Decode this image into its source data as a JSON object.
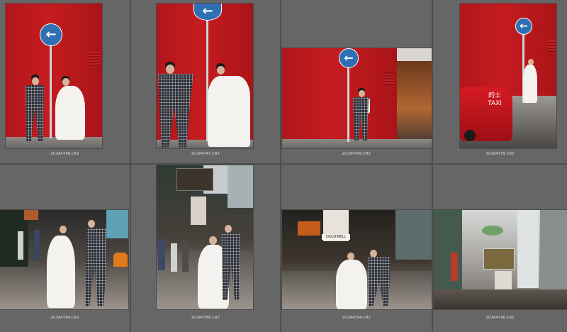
{
  "grid": {
    "background": "#5c5c5c",
    "cell_color": "#666666"
  },
  "thumbnails": [
    {
      "filename": "2U3A4746.CR2"
    },
    {
      "filename": "2U3A4747.CR2"
    },
    {
      "filename": "2U3A4750.CR2"
    },
    {
      "filename": "2U3A4759.CR2"
    },
    {
      "filename": "2U3A4784.CR2"
    },
    {
      "filename": "2U3A4788.CR2"
    },
    {
      "filename": "2U3A4794.CR2"
    },
    {
      "filename": "2U3A4796.CR2"
    }
  ],
  "signs": {
    "arrow": "←",
    "taxi_top": "的士",
    "taxi": "TAXI",
    "shop": "DOLOWELL"
  },
  "colors": {
    "red_wall": "#bf1b1f",
    "sign_blue": "#2f6fb3",
    "taxi_red": "#d51a22"
  }
}
